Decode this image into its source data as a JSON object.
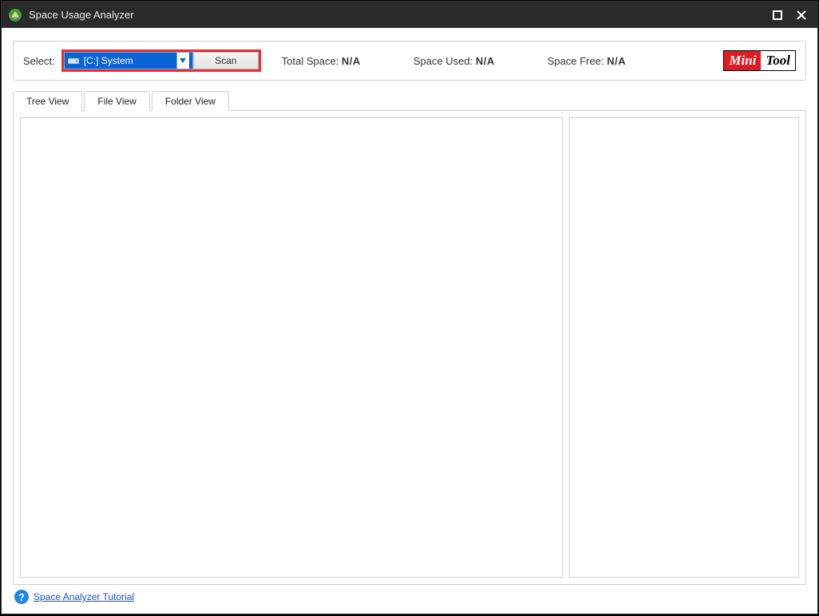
{
  "window": {
    "title": "Space Usage Analyzer"
  },
  "toolbar": {
    "select_label": "Select:",
    "drive_selected": "[C:] System",
    "scan_label": "Scan",
    "total_space_label": "Total Space:",
    "total_space_value": "N/A",
    "space_used_label": "Space Used:",
    "space_used_value": "N/A",
    "space_free_label": "Space Free:",
    "space_free_value": "N/A"
  },
  "logo": {
    "part1": "Mini",
    "part2": "Tool"
  },
  "tabs": {
    "tree": "Tree View",
    "file": "File View",
    "folder": "Folder View"
  },
  "footer": {
    "help_glyph": "?",
    "tutorial_link": "Space Analyzer Tutorial"
  }
}
